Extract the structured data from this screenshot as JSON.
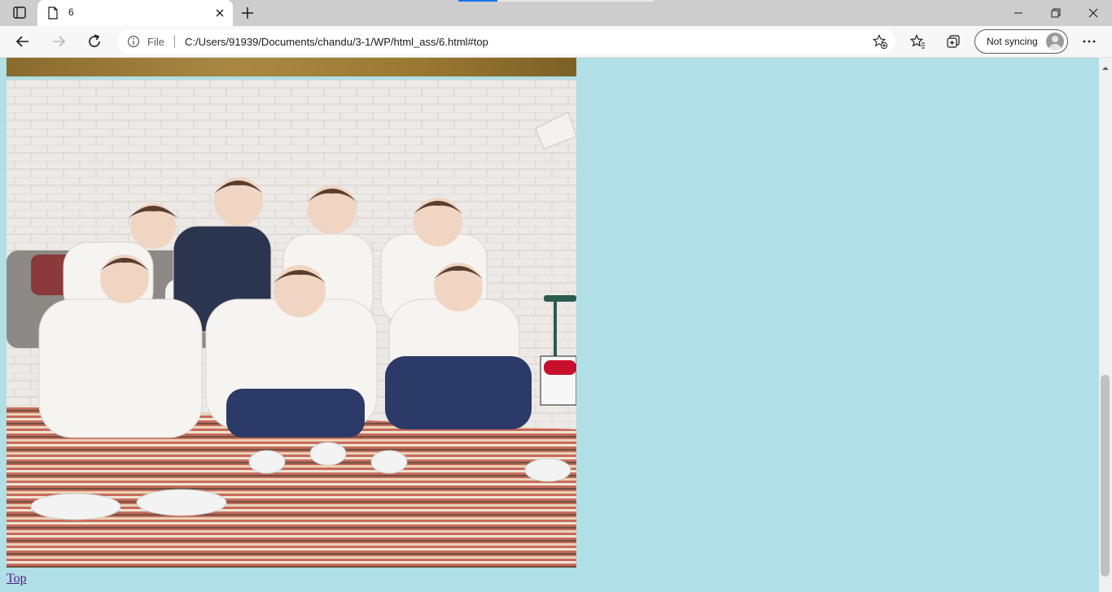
{
  "browser": {
    "tab_title": "6",
    "address_scheme_label": "File",
    "url": "C:/Users/91939/Documents/chandu/3-1/WP/html_ass/6.html#top",
    "sync_label": "Not syncing"
  },
  "icons": {
    "tab_actions": "tab-actions-icon",
    "page": "page-icon",
    "close": "close-icon",
    "new_tab": "plus-icon",
    "back": "back-arrow-icon",
    "forward": "forward-arrow-icon",
    "refresh": "refresh-icon",
    "info": "info-icon",
    "add_favorite": "star-plus-icon",
    "favorites": "favorites-icon",
    "collections": "collections-icon",
    "more": "more-icon"
  },
  "page": {
    "background_color": "#b0dfe5",
    "top_link_text": "Top"
  }
}
